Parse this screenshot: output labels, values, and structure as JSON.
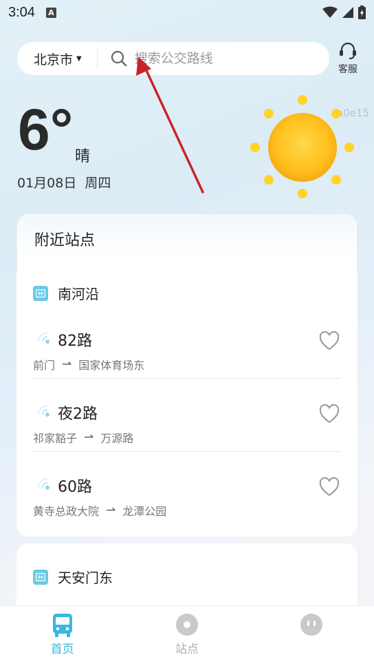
{
  "status_bar": {
    "time": "3:04",
    "notification": "A"
  },
  "header": {
    "city": "北京市",
    "search_placeholder": "搜索公交路线",
    "service_label": "客服"
  },
  "weather": {
    "temperature": "6°",
    "condition": "晴",
    "date": "01月08日",
    "weekday": "周四",
    "code_text": "a0e15",
    "icon": "sun-icon"
  },
  "nearby": {
    "title": "附近站点",
    "stops": [
      {
        "name": "南河沿",
        "routes": [
          {
            "name": "82路",
            "from": "前门",
            "to": "国家体育场东"
          },
          {
            "name": "夜2路",
            "from": "祁家豁子",
            "to": "万源路"
          },
          {
            "name": "60路",
            "from": "黄寺总政大院",
            "to": "龙潭公园"
          }
        ]
      },
      {
        "name": "天安门东",
        "routes": []
      }
    ]
  },
  "tabs": [
    {
      "label": "首页",
      "icon": "bus-icon",
      "active": true
    },
    {
      "label": "站点",
      "icon": "pin-icon",
      "active": false
    },
    {
      "label": "",
      "icon": "profile-icon",
      "active": false
    }
  ],
  "colors": {
    "accent": "#38b7e0",
    "stop_icon": "#66cbe6",
    "sun": "#ffc21a",
    "annotation_arrow": "#c9242a"
  }
}
